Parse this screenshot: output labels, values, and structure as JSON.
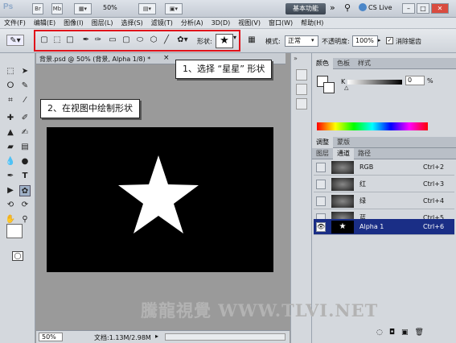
{
  "titlebar": {
    "app": "Ps",
    "br_label": "Br",
    "mb_label": "Mb",
    "zoom": "50%",
    "workspace": "基本功能",
    "cslive": "CS Live"
  },
  "menus": [
    "文件(F)",
    "编辑(E)",
    "图像(I)",
    "图层(L)",
    "选择(S)",
    "滤镜(T)",
    "分析(A)",
    "3D(D)",
    "视图(V)",
    "窗口(W)",
    "帮助(H)"
  ],
  "options": {
    "shape_label": "形状:",
    "mode_label": "模式:",
    "mode_value": "正常",
    "opacity_label": "不透明度:",
    "opacity_value": "100%",
    "antialias_label": "消除锯齿"
  },
  "document": {
    "tab_title": "背景.psd @ 50% (背景, Alpha 1/8) *",
    "zoom": "50%",
    "doc_info": "文档:1.13M/2.98M"
  },
  "callouts": {
    "step1": "1、选择 “星星” 形状",
    "step2": "2、在视图中绘制形状"
  },
  "panels": {
    "color_tabs": [
      "颜色",
      "色板",
      "样式"
    ],
    "color_k_label": "K",
    "color_k_value": "0",
    "color_k_unit": "%",
    "layer_tabs": [
      "图层",
      "通道",
      "路径"
    ],
    "adjust_tabs": [
      "调整",
      "蒙版"
    ],
    "channels": [
      {
        "name": "RGB",
        "shortcut": "Ctrl+2"
      },
      {
        "name": "红",
        "shortcut": "Ctrl+3"
      },
      {
        "name": "绿",
        "shortcut": "Ctrl+4"
      },
      {
        "name": "蓝",
        "shortcut": "Ctrl+5"
      },
      {
        "name": "Alpha 1",
        "shortcut": "Ctrl+6"
      }
    ]
  },
  "watermark": {
    "text": "騰龍視覺 WWW.TLVI.NET"
  },
  "colors": {
    "highlight": "#e0131b",
    "selected_channel": "#1a2e86"
  }
}
